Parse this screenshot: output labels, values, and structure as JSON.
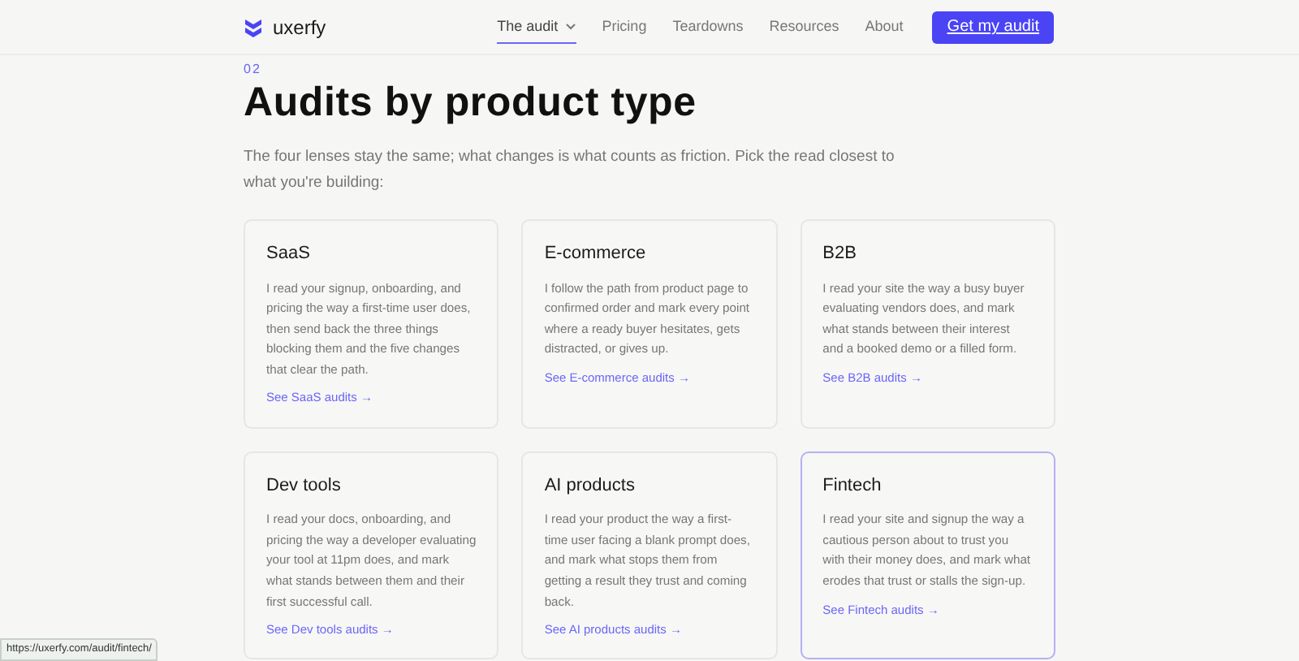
{
  "nav": {
    "logo": "uxerfy",
    "links": [
      {
        "label": "The audit",
        "selected": true,
        "dropdown": true
      },
      {
        "label": "Pricing",
        "selected": false,
        "dropdown": false
      },
      {
        "label": "Teardowns",
        "selected": false,
        "dropdown": false
      },
      {
        "label": "Resources",
        "selected": false,
        "dropdown": false
      },
      {
        "label": "About",
        "selected": false,
        "dropdown": false
      }
    ],
    "cta": "Get my audit"
  },
  "section": {
    "number": "02",
    "title": "Audits by product type",
    "intro": "The four lenses stay the same; what changes is what counts as friction. Pick the read closest to what you're building:"
  },
  "cards": [
    {
      "title": "SaaS",
      "text": "I read your signup, onboarding, and pricing the way a first-time user does, then send back the three things blocking them and the five changes that clear the path.",
      "link": "See SaaS audits →",
      "selected": false
    },
    {
      "title": "E-commerce",
      "text": "I follow the path from product page to confirmed order and mark every point where a ready buyer hesitates, gets distracted, or gives up.",
      "link": "See E-commerce audits →",
      "selected": false
    },
    {
      "title": "B2B",
      "text": "I read your site the way a busy buyer evaluating vendors does, and mark what stands between their interest and a booked demo or a filled form.",
      "link": "See B2B audits →",
      "selected": false
    },
    {
      "title": "Dev tools",
      "text": "I read your docs, onboarding, and pricing the way a developer evaluating your tool at 11pm does, and mark what stands between them and their first successful call.",
      "link": "See Dev tools audits →",
      "selected": false
    },
    {
      "title": "AI products",
      "text": "I read your product the way a first-time user facing a blank prompt does, and mark what stops them from getting a result they trust and coming back.",
      "link": "See AI products audits →",
      "selected": false
    },
    {
      "title": "Fintech",
      "text": "I read your site and signup the way a cautious person about to trust you with their money does, and mark what erodes that trust or stalls the sign-up.",
      "link": "See Fintech audits →",
      "selected": true
    }
  ],
  "status_bar": {
    "url": "https://uxerfy.com/audit/fintech/"
  }
}
